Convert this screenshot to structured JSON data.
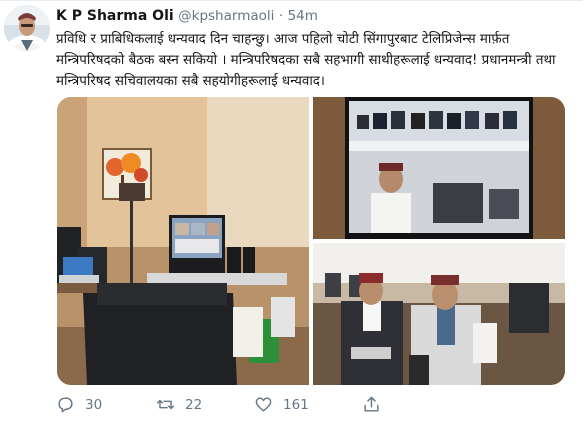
{
  "tweet": {
    "display_name": "K P Sharma Oli",
    "handle": "@kpsharmaoli",
    "separator": "·",
    "time": "54m",
    "text": "प्रविधि र प्राबिधिकलाई धन्यवाद दिन चाहन्छु। आज पहिलो चोटी सिंगापुरबाट टेलिप्रिजेन्स मार्फ़त मन्त्रिपरिषदको बैठक बस्न सकियो । मन्त्रिपरिषदका सबै सहभागी साथीहरूलाई धन्यवाद! प्रधानमन्त्री तथा मन्त्रिपरिषद सचिवालयका सबै सहयोगीहरूलाई धन्यवाद।"
  },
  "actions": {
    "replies": "30",
    "retweets": "22",
    "likes": "161"
  },
  "icons": {
    "reply": "reply-icon",
    "retweet": "retweet-icon",
    "like": "heart-icon",
    "share": "share-icon"
  },
  "colors": {
    "secondary_text": "#657786",
    "primary_text": "#14171a"
  }
}
